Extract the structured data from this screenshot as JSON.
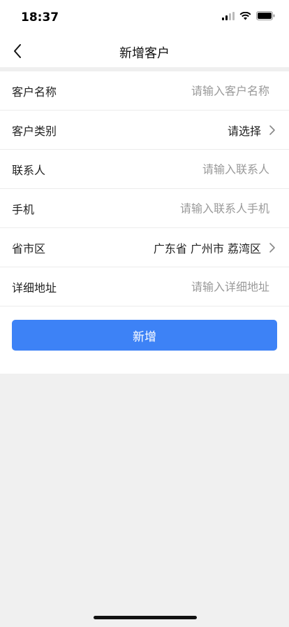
{
  "status_bar": {
    "time": "18:37"
  },
  "nav": {
    "title": "新增客户"
  },
  "form": {
    "customer_name": {
      "label": "客户名称",
      "placeholder": "请输入客户名称"
    },
    "customer_type": {
      "label": "客户类别",
      "value": "请选择"
    },
    "contact": {
      "label": "联系人",
      "placeholder": "请输入联系人"
    },
    "phone": {
      "label": "手机",
      "placeholder": "请输入联系人手机"
    },
    "region": {
      "label": "省市区",
      "value": "广东省 广州市 荔湾区"
    },
    "address": {
      "label": "详细地址",
      "placeholder": "请输入详细地址"
    }
  },
  "submit_label": "新增",
  "colors": {
    "primary": "#3d82f6",
    "background": "#f0f0f0"
  }
}
